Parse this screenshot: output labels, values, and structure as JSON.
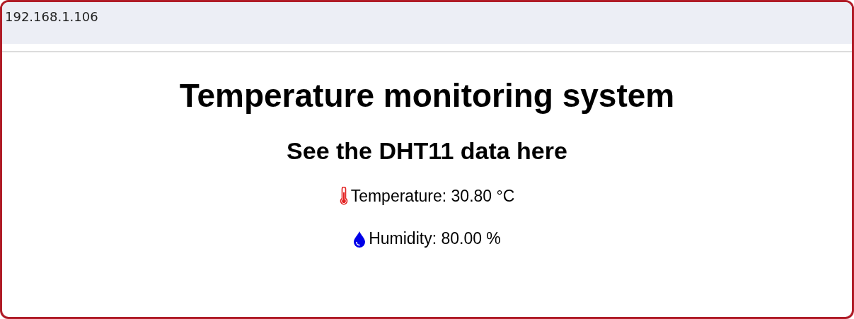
{
  "address_bar": {
    "url": "192.168.1.106"
  },
  "page": {
    "title": "Temperature monitoring system",
    "subtitle": "See the DHT11 data here",
    "readings": [
      {
        "kind": "temperature",
        "text": "Temperature: 30.80 °C"
      },
      {
        "kind": "humidity",
        "text": "Humidity: 80.00 %"
      }
    ]
  }
}
